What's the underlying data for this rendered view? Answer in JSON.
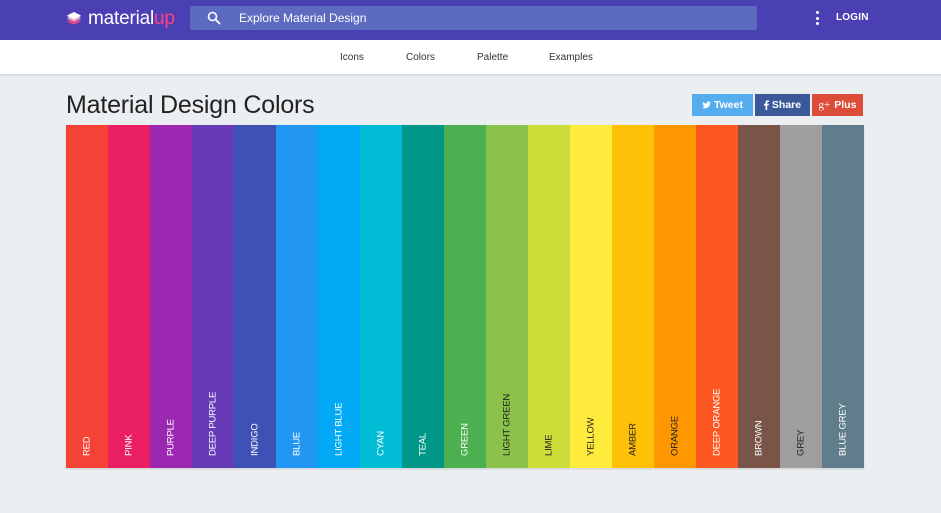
{
  "header": {
    "logo_main": "material",
    "logo_accent": "up",
    "search_placeholder": "Explore Material Design",
    "more_icon": "more-vertical-icon",
    "login_label": "LOGIN"
  },
  "subnav": {
    "items": [
      {
        "label": "Icons"
      },
      {
        "label": "Colors"
      },
      {
        "label": "Palette"
      },
      {
        "label": "Examples"
      }
    ]
  },
  "page": {
    "title": "Material Design Colors"
  },
  "social": {
    "tweet_label": "Tweet",
    "share_label": "Share",
    "plus_label": "Plus"
  },
  "colors": {
    "brand": "#4a40b3",
    "accent": "#ff4081",
    "swatches": [
      {
        "name": "RED",
        "color": "#f44336",
        "text": "#ffffff"
      },
      {
        "name": "PINK",
        "color": "#e91e63",
        "text": "#ffffff"
      },
      {
        "name": "PURPLE",
        "color": "#9c27b0",
        "text": "#ffffff"
      },
      {
        "name": "DEEP PURPLE",
        "color": "#673ab7",
        "text": "#ffffff"
      },
      {
        "name": "INDIGO",
        "color": "#3f51b5",
        "text": "#ffffff"
      },
      {
        "name": "BLUE",
        "color": "#2196f3",
        "text": "#ffffff"
      },
      {
        "name": "LIGHT BLUE",
        "color": "#03a9f4",
        "text": "#ffffff"
      },
      {
        "name": "CYAN",
        "color": "#00bcd4",
        "text": "#ffffff"
      },
      {
        "name": "TEAL",
        "color": "#009688",
        "text": "#ffffff"
      },
      {
        "name": "GREEN",
        "color": "#4caf50",
        "text": "#ffffff"
      },
      {
        "name": "LIGHT GREEN",
        "color": "#8bc34a",
        "text": "#222222"
      },
      {
        "name": "LIME",
        "color": "#cddc39",
        "text": "#222222"
      },
      {
        "name": "YELLOW",
        "color": "#ffeb3b",
        "text": "#222222"
      },
      {
        "name": "AMBER",
        "color": "#ffc107",
        "text": "#222222"
      },
      {
        "name": "ORANGE",
        "color": "#ff9800",
        "text": "#222222"
      },
      {
        "name": "DEEP ORANGE",
        "color": "#ff5722",
        "text": "#ffffff"
      },
      {
        "name": "BROWN",
        "color": "#795548",
        "text": "#ffffff"
      },
      {
        "name": "GREY",
        "color": "#9e9e9e",
        "text": "#222222"
      },
      {
        "name": "BLUE GREY",
        "color": "#607d8b",
        "text": "#ffffff"
      }
    ]
  }
}
